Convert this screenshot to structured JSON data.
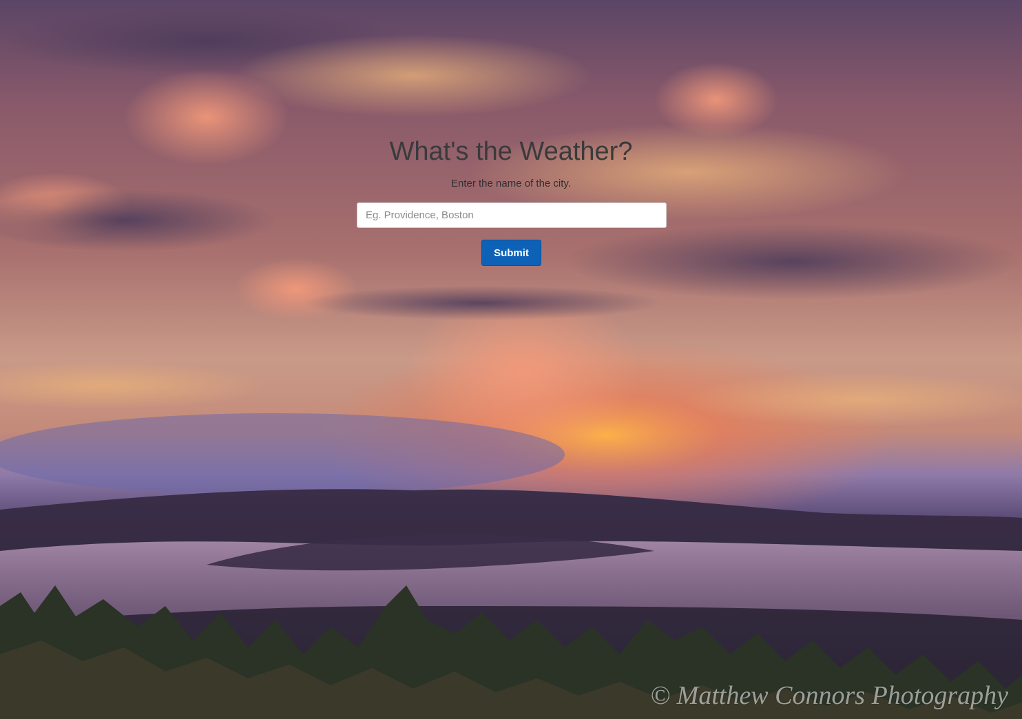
{
  "page": {
    "title": "What's the Weather?",
    "subtitle": "Enter the name of the city."
  },
  "form": {
    "city_placeholder": "Eg. Providence, Boston",
    "city_value": "",
    "submit_label": "Submit"
  },
  "background": {
    "watermark": "© Matthew Connors Photography"
  },
  "colors": {
    "button": "#0d62b8",
    "title_text": "#3a3a3c"
  }
}
